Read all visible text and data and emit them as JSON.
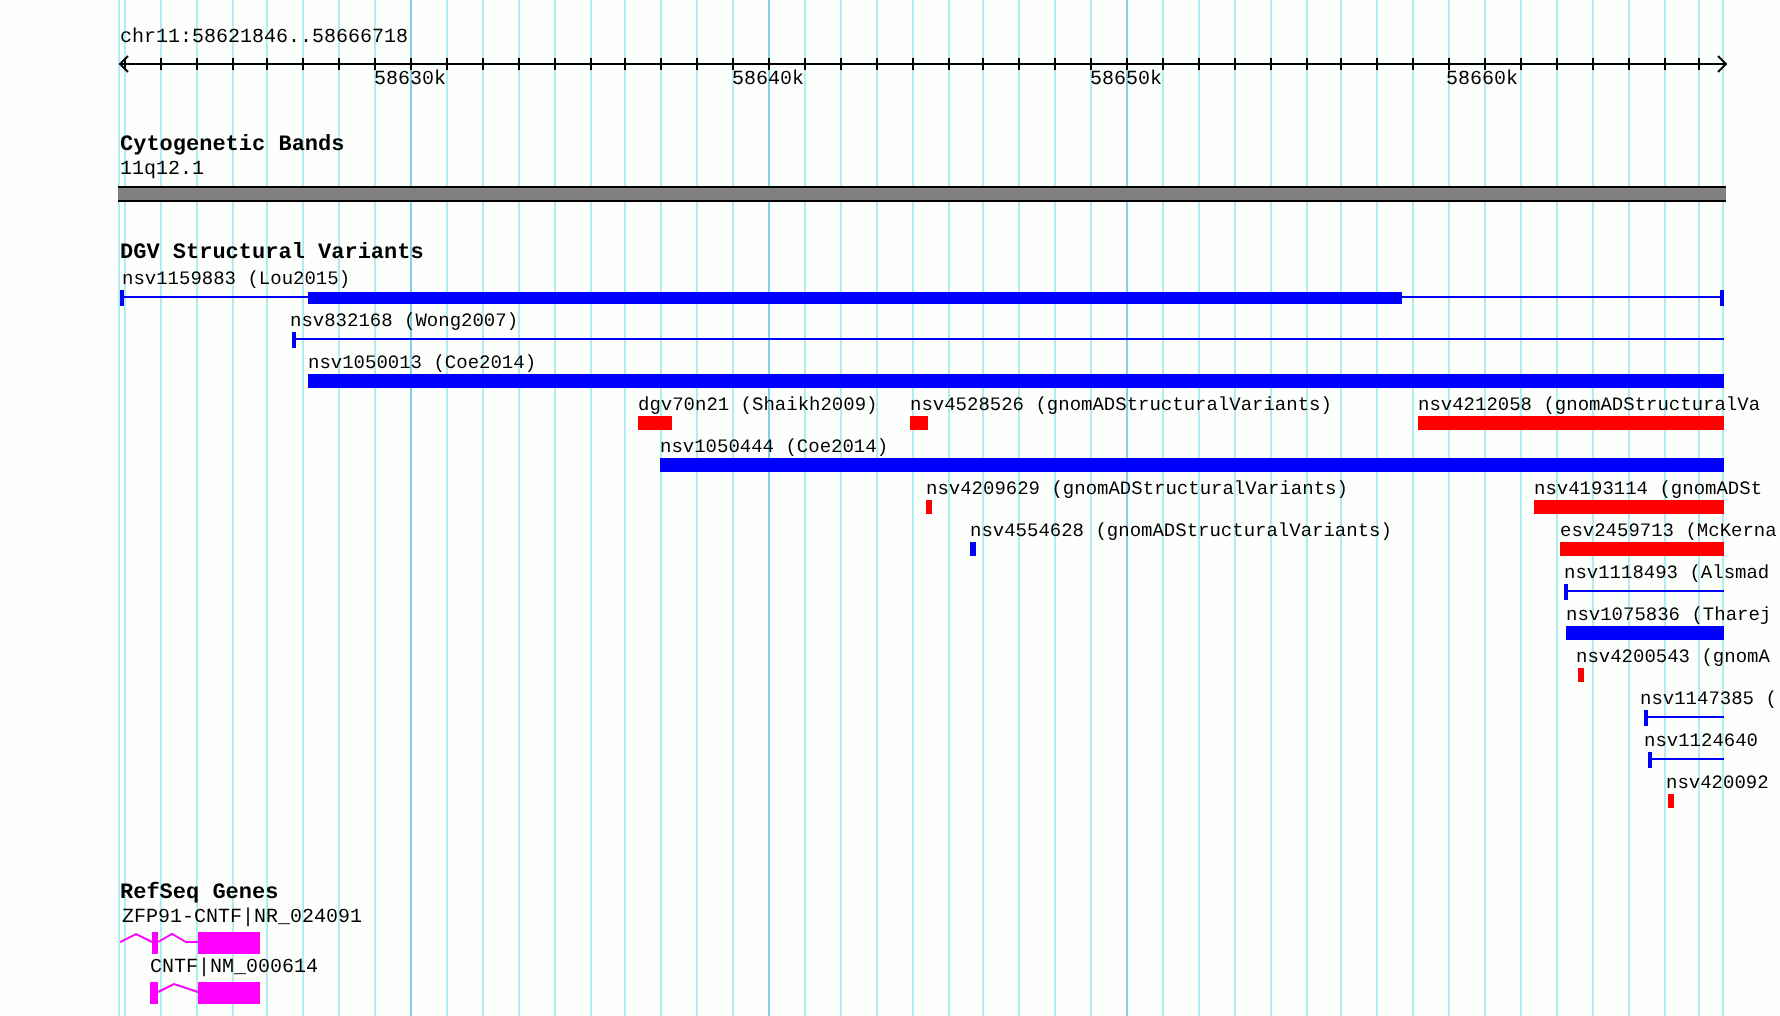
{
  "ruler": {
    "location": "chr11:58621846..58666718",
    "ticks": [
      "58630k",
      "58640k",
      "58650k",
      "58660k"
    ]
  },
  "bands_track": {
    "title": "Cytogenetic Bands",
    "band": "11q12.1"
  },
  "variants_track": {
    "title": "DGV Structural Variants",
    "features": [
      {
        "label": "nsv1159883 (Lou2015)",
        "kind": "split",
        "color": "#0000ff"
      },
      {
        "label": "nsv832168 (Wong2007)",
        "kind": "line",
        "color": "#0000ff"
      },
      {
        "label": "nsv1050013 (Coe2014)",
        "kind": "block",
        "color": "#0000ff"
      },
      {
        "label": "dgv70n21 (Shaikh2009)",
        "kind": "block",
        "color": "#ff0000"
      },
      {
        "label": "nsv4528526 (gnomADStructuralVariants)",
        "kind": "block",
        "color": "#ff0000"
      },
      {
        "label": "nsv4212058 (gnomADStructuralVa",
        "kind": "block",
        "color": "#ff0000"
      },
      {
        "label": "nsv1050444 (Coe2014)",
        "kind": "block",
        "color": "#0000ff"
      },
      {
        "label": "nsv4209629 (gnomADStructuralVariants)",
        "kind": "block",
        "color": "#ff0000"
      },
      {
        "label": "nsv4193114 (gnomADSt",
        "kind": "block",
        "color": "#ff0000"
      },
      {
        "label": "nsv4554628 (gnomADStructuralVariants)",
        "kind": "block",
        "color": "#0000ff"
      },
      {
        "label": "esv2459713 (McKerna",
        "kind": "block",
        "color": "#ff0000"
      },
      {
        "label": "nsv1118493 (Alsmad",
        "kind": "line",
        "color": "#0000ff"
      },
      {
        "label": "nsv1075836 (Tharej",
        "kind": "block",
        "color": "#0000ff"
      },
      {
        "label": "nsv4200543 (gnomA",
        "kind": "block",
        "color": "#ff0000"
      },
      {
        "label": "nsv1147385 (",
        "kind": "line",
        "color": "#0000ff"
      },
      {
        "label": "nsv1124640",
        "kind": "line",
        "color": "#0000ff"
      },
      {
        "label": "nsv420092",
        "kind": "block",
        "color": "#ff0000"
      }
    ]
  },
  "genes_track": {
    "title": "RefSeq Genes",
    "genes": [
      {
        "label": "ZFP91-CNTF|NR_024091",
        "kind": "two-exon"
      },
      {
        "label": "CNTF|NM_000614",
        "kind": "one-exon"
      }
    ]
  }
}
